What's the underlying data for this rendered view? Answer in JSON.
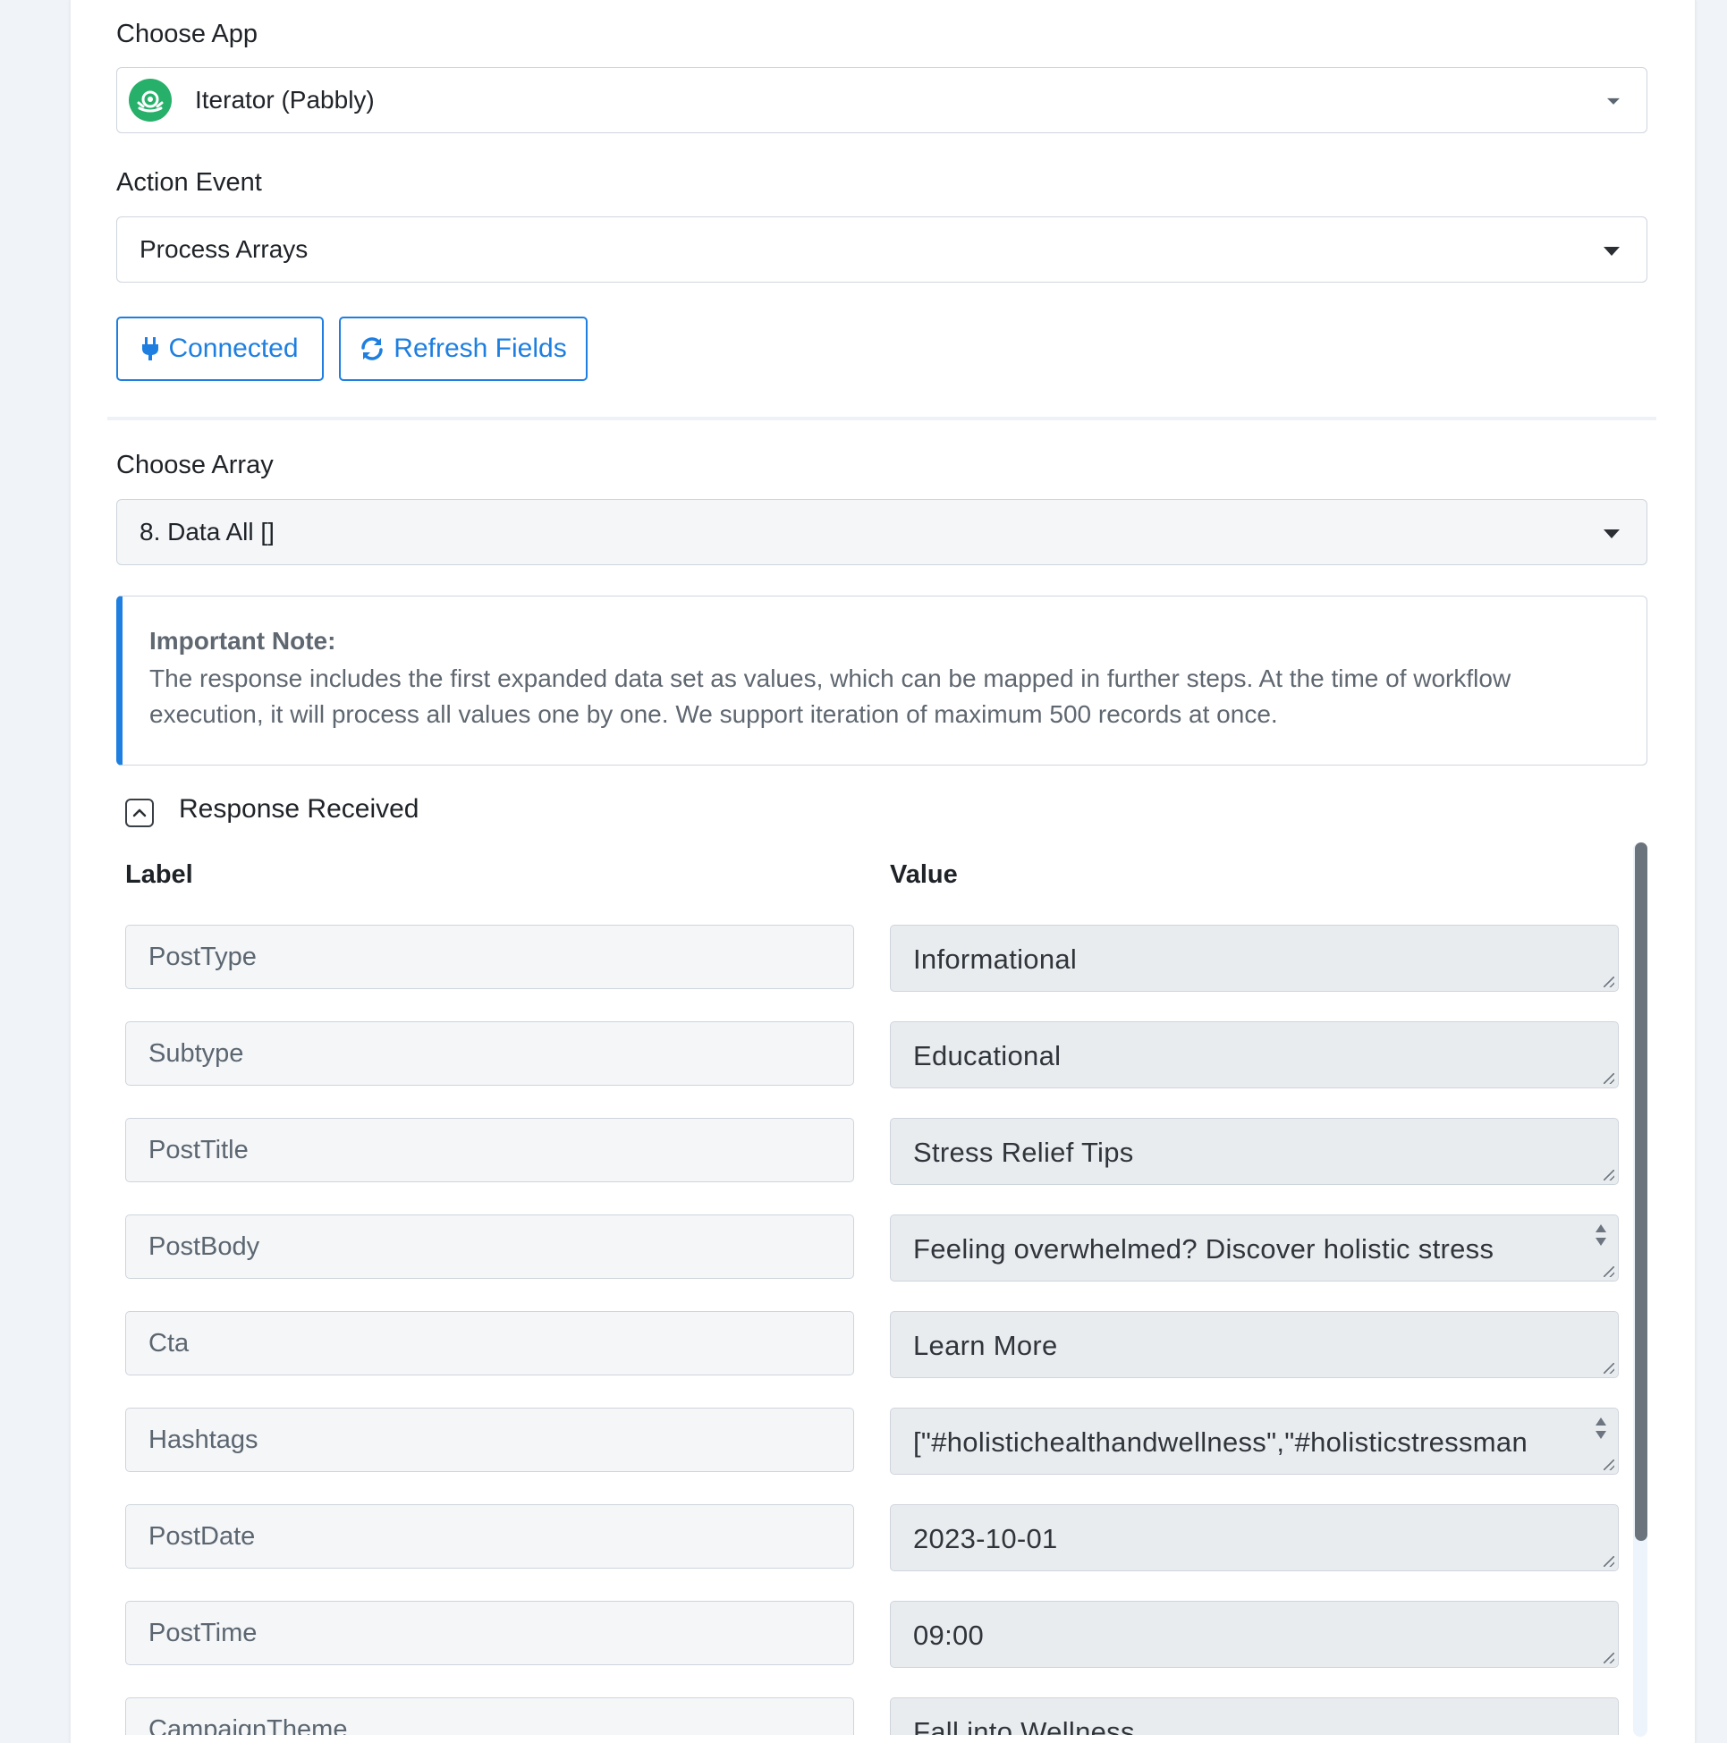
{
  "app_section": {
    "label": "Choose App",
    "selected": "Iterator (Pabbly)",
    "logo_icon": "iterator-logo-icon",
    "logo_color": "#27b06a"
  },
  "action_event": {
    "label": "Action Event",
    "selected": "Process Arrays"
  },
  "buttons": {
    "connected": "Connected",
    "refresh": "Refresh Fields",
    "accent_color": "#1e7fe0"
  },
  "array_section": {
    "label": "Choose Array",
    "selected": "8. Data All []"
  },
  "note": {
    "title": "Important Note:",
    "body": "The response includes the first expanded data set as values, which can be mapped in further steps. At the time of workflow execution, it will process all values one by one. We support iteration of maximum 500 records at once."
  },
  "response": {
    "title": "Response Received",
    "col_label": "Label",
    "col_value": "Value",
    "rows": [
      {
        "label": "PostType",
        "value": "Informational"
      },
      {
        "label": "Subtype",
        "value": "Educational"
      },
      {
        "label": "PostTitle",
        "value": "Stress Relief Tips"
      },
      {
        "label": "PostBody",
        "value": "Feeling overwhelmed? Discover holistic stress"
      },
      {
        "label": "Cta",
        "value": "Learn More"
      },
      {
        "label": "Hashtags",
        "value": "[\"#holistichealthandwellness\",\"#holisticstressman"
      },
      {
        "label": "PostDate",
        "value": "2023-10-01"
      },
      {
        "label": "PostTime",
        "value": "09:00"
      },
      {
        "label": "CampaignTheme",
        "value": "Fall into Wellness"
      }
    ]
  }
}
